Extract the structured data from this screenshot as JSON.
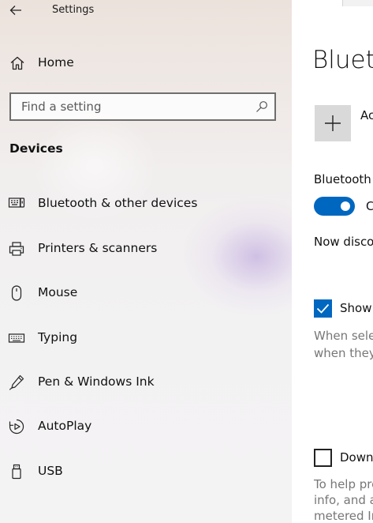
{
  "window": {
    "title": "Settings"
  },
  "sidebar": {
    "home_label": "Home",
    "search_placeholder": "Find a setting",
    "section_title": "Devices",
    "items": [
      {
        "label": "Bluetooth & other devices",
        "icon": "bluetooth-devices-icon"
      },
      {
        "label": "Printers & scanners",
        "icon": "printer-icon"
      },
      {
        "label": "Mouse",
        "icon": "mouse-icon"
      },
      {
        "label": "Typing",
        "icon": "keyboard-icon"
      },
      {
        "label": "Pen & Windows Ink",
        "icon": "pen-icon"
      },
      {
        "label": "AutoPlay",
        "icon": "autoplay-icon"
      },
      {
        "label": "USB",
        "icon": "usb-icon"
      }
    ]
  },
  "main": {
    "heading": "Blueto",
    "add_label": "Ac",
    "bluetooth_label": "Bluetooth",
    "toggle_state_label": "C",
    "toggle_on": true,
    "discoverable_text": "Now disco",
    "swift_pair": {
      "checked": true,
      "label": "Show",
      "description": [
        "When sele",
        "when they"
      ]
    },
    "metered": {
      "checked": false,
      "label": "Down",
      "description": [
        "To help pre",
        "info, and a",
        "metered In"
      ]
    }
  },
  "colors": {
    "accent": "#0067c0",
    "tile": "#d9d9d9",
    "secondary_text": "#777777"
  }
}
